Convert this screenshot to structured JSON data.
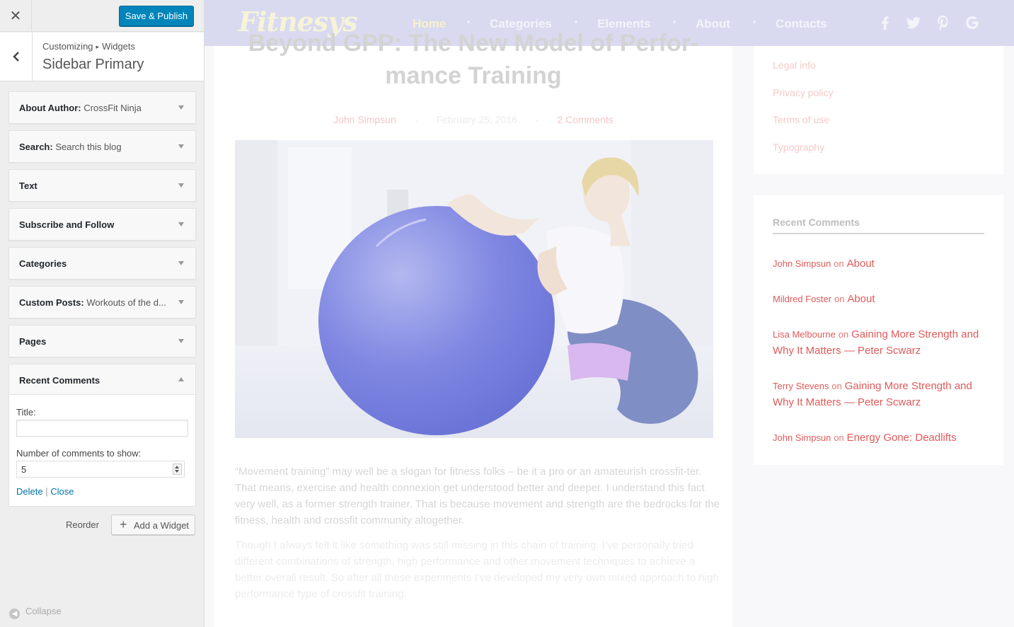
{
  "customizer": {
    "close_icon": "close-icon",
    "publish_label": "Save & Publish",
    "breadcrumb": {
      "parent": "Customizing",
      "current": "Widgets"
    },
    "section_title": "Sidebar Primary",
    "widgets": [
      {
        "name": "About Author",
        "sub": "CrossFit Ninja"
      },
      {
        "name": "Search",
        "sub": "Search this blog"
      },
      {
        "name": "Text",
        "sub": ""
      },
      {
        "name": "Subscribe and Follow",
        "sub": ""
      },
      {
        "name": "Categories",
        "sub": ""
      },
      {
        "name": "Custom Posts",
        "sub": "Workouts of the d..."
      },
      {
        "name": "Pages",
        "sub": ""
      }
    ],
    "recent_comments_widget": {
      "title": "Recent Comments",
      "title_label": "Title:",
      "title_value": "",
      "count_label": "Number of comments to show:",
      "count_value": "5",
      "delete_label": "Delete",
      "separator": "|",
      "close_label": "Close"
    },
    "reorder_label": "Reorder",
    "add_widget_label": "Add a Widget",
    "collapse_label": "Collapse"
  },
  "site": {
    "logo": "Fitnesys",
    "nav": [
      "Home",
      "Categories",
      "Elements",
      "About",
      "Contacts"
    ],
    "nav_separator": "•",
    "social_icons": [
      "facebook-icon",
      "twitter-icon",
      "pinterest-icon",
      "google-icon"
    ],
    "post": {
      "title_line1": "Beyond GPP: The New Model of Perfor-",
      "title_line2": "mance Training",
      "author": "John Simpsun",
      "date": "February 25, 2016",
      "comments": "2 Comments",
      "meta_separator": "·",
      "paragraph1": "“Movement training” may well be a slogan for fitness folks – be it a pro or an amateurish crossfit-ter. That means, exercise and health connexion get understood better and deeper. I understand this fact very well, as a former strength trainer. That is because movement and strength are the bedrocks for the fitness, health and crossfit community altogether.",
      "paragraph2": "Though I always felt it like something was still missing in this chain of training. I’ve personally tried different combinations of strength, high performance and other movement techniques to achieve a better overall result. So after all these experiments I’ve developed my very own mixed approach to high performance type of crossfit training."
    },
    "sidebar_links": [
      "Legal info",
      "Privacy policy",
      "Terms of use",
      "Typography"
    ],
    "recent_comments": {
      "heading": "Recent Comments",
      "on": "on",
      "items": [
        {
          "author": "John Simpsun",
          "post": "About"
        },
        {
          "author": "Mildred Foster",
          "post": "About"
        },
        {
          "author": "Lisa Melbourne",
          "post": "Gaining More Strength and Why It Matters — Peter Scwarz"
        },
        {
          "author": "Terry Stevens",
          "post": "Gaining More Strength and Why It Matters — Peter Scwarz"
        },
        {
          "author": "John Simpsun",
          "post": "Energy Gone: Deadlifts"
        }
      ]
    }
  },
  "colors": {
    "publish_blue": "#0085ba",
    "link_blue": "#0073aa",
    "comment_red": "#e05a5a",
    "nav_bg": "#d9daf0"
  }
}
